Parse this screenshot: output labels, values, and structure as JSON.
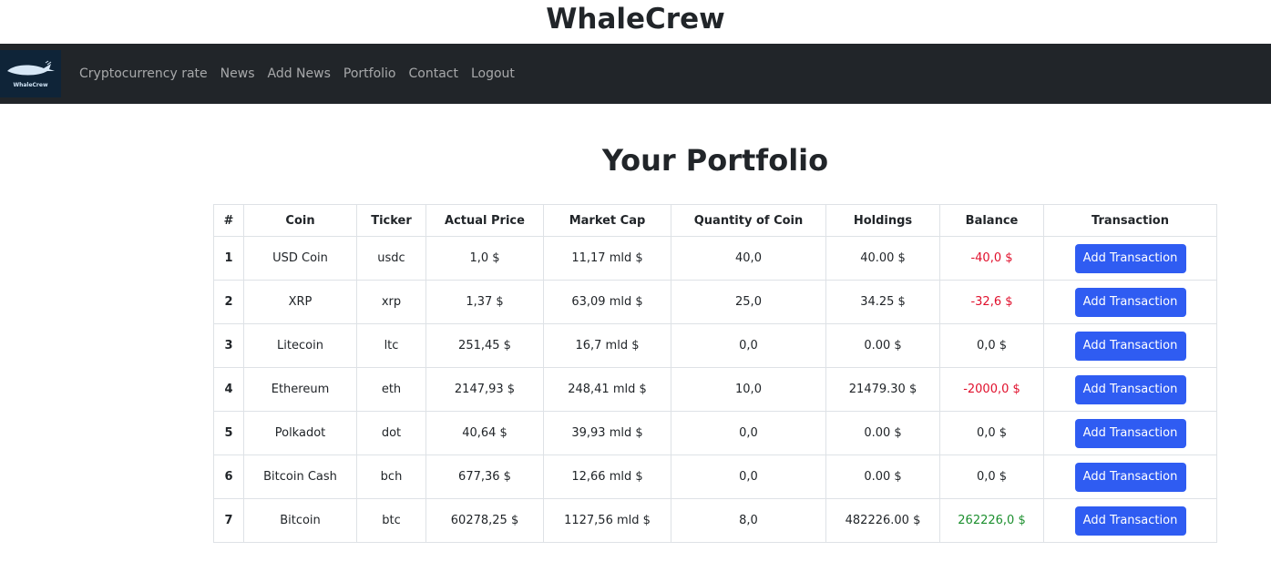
{
  "site": {
    "title": "WhaleCrew"
  },
  "brand": {
    "logo_text": "WhaleCrew"
  },
  "nav": {
    "items": [
      {
        "label": "Cryptocurrency rate"
      },
      {
        "label": "News"
      },
      {
        "label": "Add News"
      },
      {
        "label": "Portfolio"
      },
      {
        "label": "Contact"
      },
      {
        "label": "Logout"
      }
    ]
  },
  "page": {
    "heading": "Your Portfolio"
  },
  "table": {
    "headers": [
      "#",
      "Coin",
      "Ticker",
      "Actual Price",
      "Market Cap",
      "Quantity of Coin",
      "Holdings",
      "Balance",
      "Transaction"
    ],
    "button_label": "Add Transaction",
    "rows": [
      {
        "num": "1",
        "coin": "USD Coin",
        "ticker": "usdc",
        "price": "1,0 $",
        "market_cap": "11,17 mld $",
        "quantity": "40,0",
        "holdings": "40.00 $",
        "balance": "-40,0 $",
        "balance_state": "negative"
      },
      {
        "num": "2",
        "coin": "XRP",
        "ticker": "xrp",
        "price": "1,37 $",
        "market_cap": "63,09 mld $",
        "quantity": "25,0",
        "holdings": "34.25 $",
        "balance": "-32,6 $",
        "balance_state": "negative"
      },
      {
        "num": "3",
        "coin": "Litecoin",
        "ticker": "ltc",
        "price": "251,45 $",
        "market_cap": "16,7 mld $",
        "quantity": "0,0",
        "holdings": "0.00 $",
        "balance": "0,0 $",
        "balance_state": "neutral"
      },
      {
        "num": "4",
        "coin": "Ethereum",
        "ticker": "eth",
        "price": "2147,93 $",
        "market_cap": "248,41 mld $",
        "quantity": "10,0",
        "holdings": "21479.30 $",
        "balance": "-2000,0 $",
        "balance_state": "negative"
      },
      {
        "num": "5",
        "coin": "Polkadot",
        "ticker": "dot",
        "price": "40,64 $",
        "market_cap": "39,93 mld $",
        "quantity": "0,0",
        "holdings": "0.00 $",
        "balance": "0,0 $",
        "balance_state": "neutral"
      },
      {
        "num": "6",
        "coin": "Bitcoin Cash",
        "ticker": "bch",
        "price": "677,36 $",
        "market_cap": "12,66 mld $",
        "quantity": "0,0",
        "holdings": "0.00 $",
        "balance": "0,0 $",
        "balance_state": "neutral"
      },
      {
        "num": "7",
        "coin": "Bitcoin",
        "ticker": "btc",
        "price": "60278,25 $",
        "market_cap": "1127,56 mld $",
        "quantity": "8,0",
        "holdings": "482226.00 $",
        "balance": "262226,0 $",
        "balance_state": "positive"
      }
    ]
  },
  "colors": {
    "navbar": "#212529",
    "button": "#2f5cf2",
    "negative": "#e0102c",
    "positive": "#1c8f2e"
  }
}
